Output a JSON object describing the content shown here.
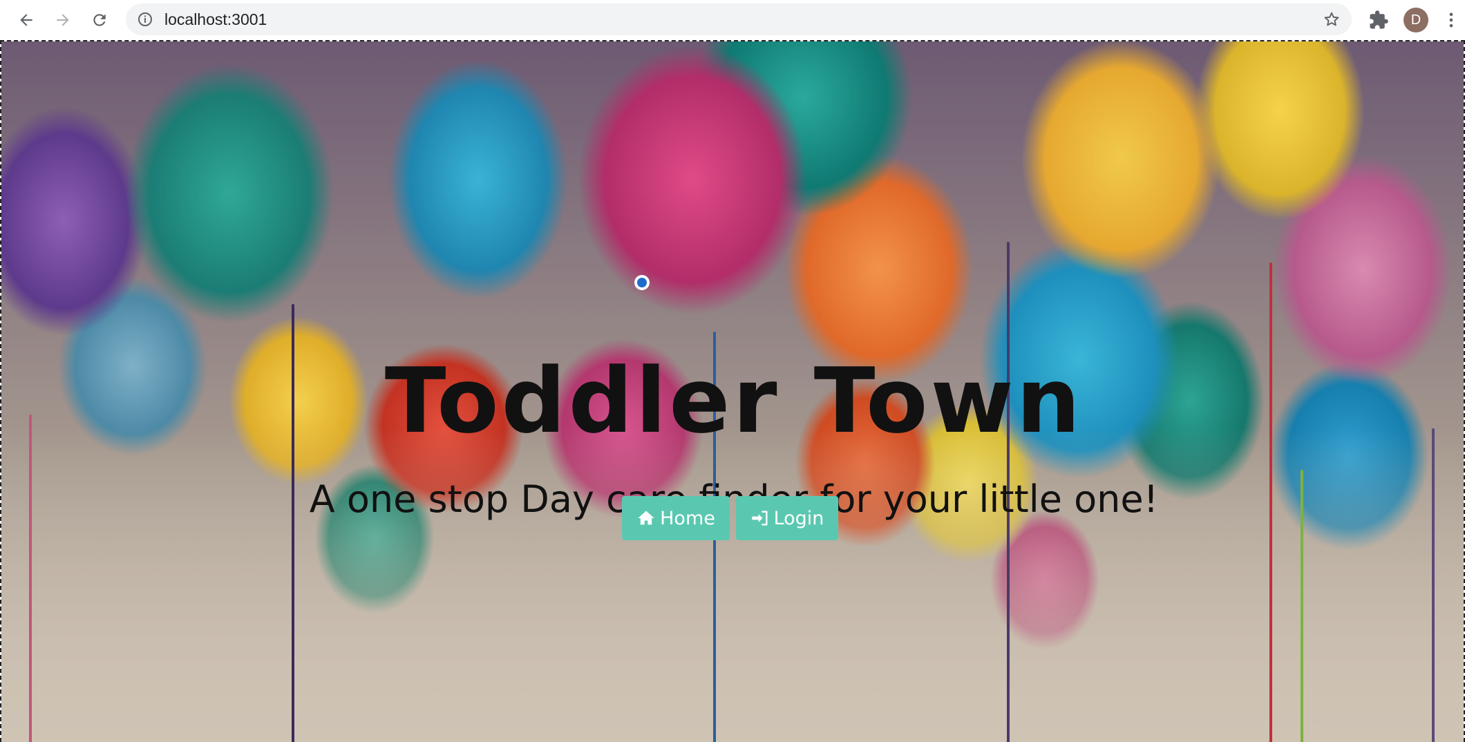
{
  "browser": {
    "url": "localhost:3001",
    "profile_initial": "D",
    "icons": {
      "back": "back-arrow-icon",
      "forward": "forward-arrow-icon",
      "reload": "reload-icon",
      "site_info": "info-icon",
      "bookmark": "star-icon",
      "extensions": "puzzle-icon",
      "menu": "more-vert-icon"
    }
  },
  "hero": {
    "title": "Toddler Town",
    "subtitle": "A one stop Day care finder for your little one!",
    "buttons": [
      {
        "label": "Home",
        "icon": "home-icon"
      },
      {
        "label": "Login",
        "icon": "sign-in-icon"
      }
    ],
    "button_color": "#5ac8b0"
  }
}
